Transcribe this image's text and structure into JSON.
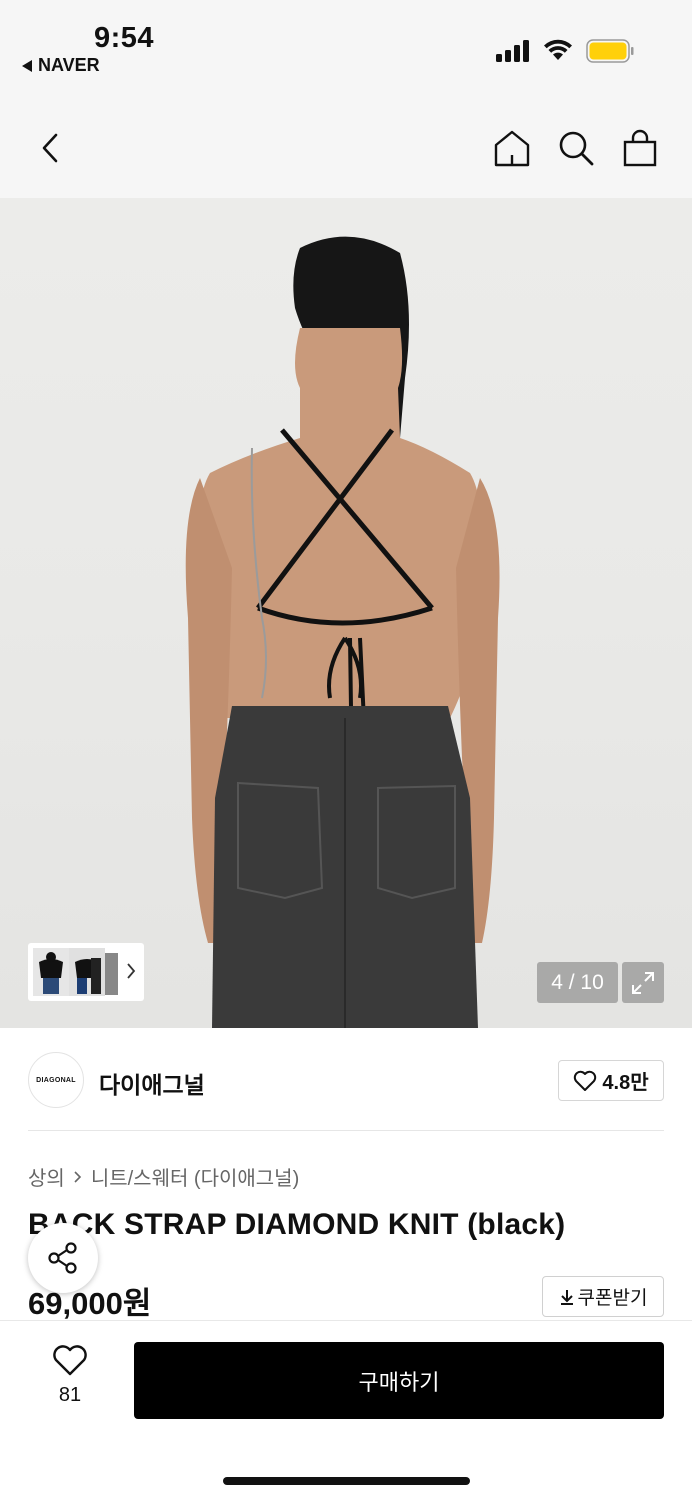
{
  "status_bar": {
    "time": "9:54",
    "back_app": "NAVER",
    "battery_color": "#ffd00a"
  },
  "nav": {
    "back_icon": "chevron-left-icon",
    "home_icon": "home-icon",
    "search_icon": "search-icon",
    "cart_icon": "shopping-bag-icon"
  },
  "gallery": {
    "page_counter": "4 / 10",
    "expand_icon": "expand-icon"
  },
  "brand": {
    "logo_text": "DIAGONAL",
    "name": "다이애그널",
    "like_count": "4.8만"
  },
  "product": {
    "breadcrumb": [
      "상의",
      "니트/스웨터 (다이애그널)"
    ],
    "title": "BACK STRAP DIAMOND KNIT (black)",
    "price": "69,000원",
    "coupon_label": "쿠폰받기"
  },
  "bottom": {
    "wish_count": "81",
    "buy_label": "구매하기"
  }
}
